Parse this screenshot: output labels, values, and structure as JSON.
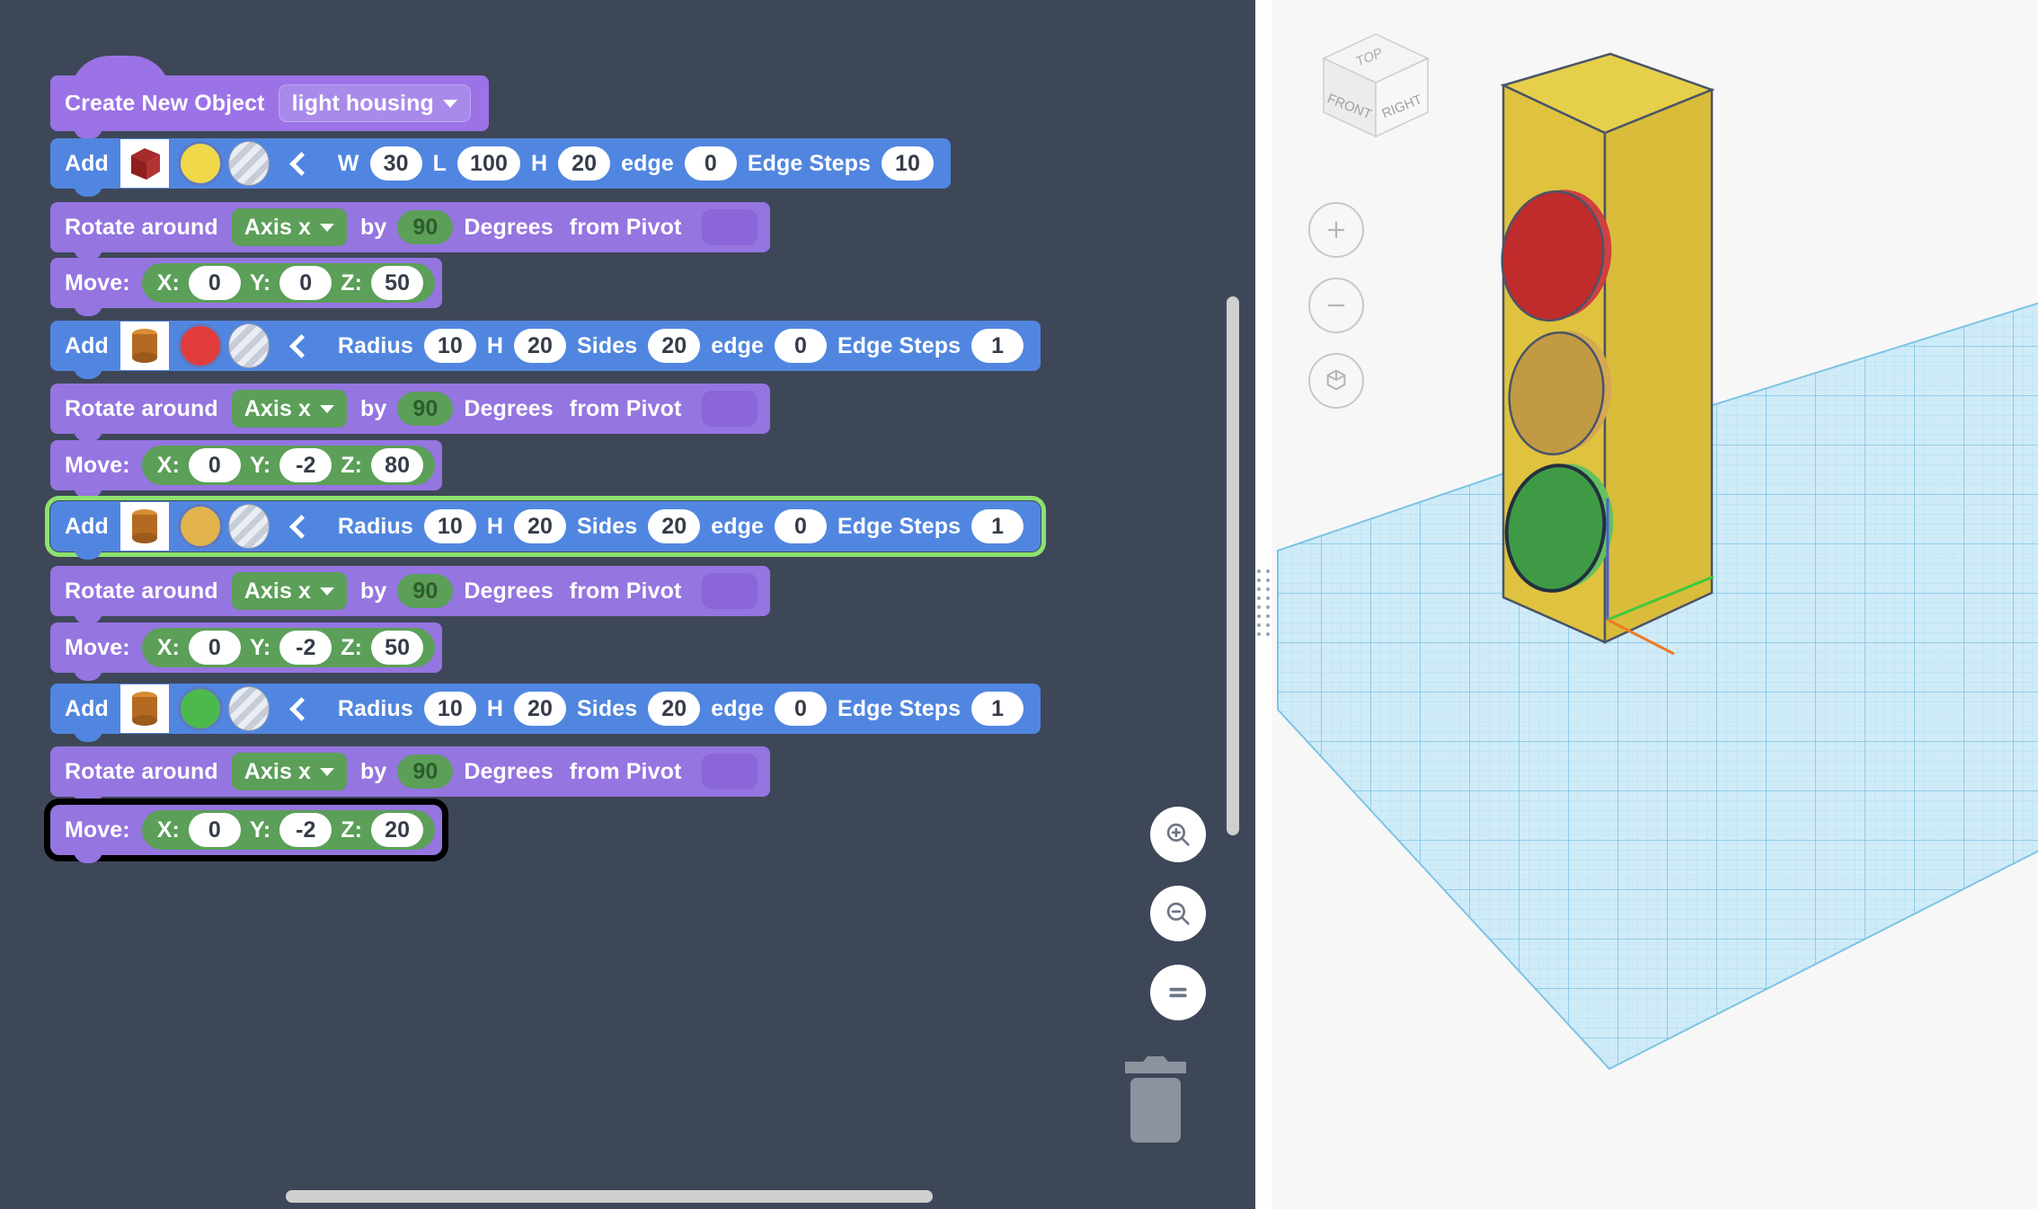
{
  "app": {
    "background_color": "#3e4758",
    "block_purple": "#9575e0",
    "block_blue": "#5186e0",
    "block_green": "#5b9f58",
    "selection_green": "#8ce26e",
    "selection_black": "#000000"
  },
  "editor": {
    "hat": {
      "label": "Create New Object",
      "object_name": "light housing",
      "dropdown_icon": "chevron-down-icon"
    },
    "blocks": [
      {
        "type": "add",
        "label": "Add",
        "shape": "box",
        "shape_thumb": "red-box-thumbnail",
        "color_swatch": "#f0d84a",
        "texture_swatch": "striped-grey",
        "back_icon": "chevron-left-icon",
        "fields": [
          {
            "label": "W",
            "value": "30"
          },
          {
            "label": "L",
            "value": "100"
          },
          {
            "label": "H",
            "value": "20"
          },
          {
            "label": "edge",
            "value": "0"
          },
          {
            "label": "Edge Steps",
            "value": "10"
          }
        ],
        "selected": "none"
      },
      {
        "type": "rotate",
        "label": "Rotate around",
        "axis": "Axis x",
        "by_label": "by",
        "degrees": "90",
        "degrees_label": "Degrees",
        "pivot_label": "from Pivot",
        "pivot_value": "",
        "selected": "none"
      },
      {
        "type": "move",
        "label": "Move:",
        "x_label": "X:",
        "x": "0",
        "y_label": "Y:",
        "y": "0",
        "z_label": "Z:",
        "z": "50",
        "selected": "none"
      },
      {
        "type": "add",
        "label": "Add",
        "shape": "cylinder",
        "shape_thumb": "orange-cylinder-thumbnail",
        "color_swatch": "#e23b3b",
        "texture_swatch": "striped-grey",
        "back_icon": "chevron-left-icon",
        "fields": [
          {
            "label": "Radius",
            "value": "10"
          },
          {
            "label": "H",
            "value": "20"
          },
          {
            "label": "Sides",
            "value": "20"
          },
          {
            "label": "edge",
            "value": "0"
          },
          {
            "label": "Edge Steps",
            "value": "1"
          }
        ],
        "selected": "none"
      },
      {
        "type": "rotate",
        "label": "Rotate around",
        "axis": "Axis x",
        "by_label": "by",
        "degrees": "90",
        "degrees_label": "Degrees",
        "pivot_label": "from Pivot",
        "pivot_value": "",
        "selected": "none"
      },
      {
        "type": "move",
        "label": "Move:",
        "x_label": "X:",
        "x": "0",
        "y_label": "Y:",
        "y": "-2",
        "z_label": "Z:",
        "z": "80",
        "selected": "none"
      },
      {
        "type": "add",
        "label": "Add",
        "shape": "cylinder",
        "shape_thumb": "orange-cylinder-thumbnail",
        "color_swatch": "#e3b44c",
        "texture_swatch": "striped-grey",
        "back_icon": "chevron-left-icon",
        "fields": [
          {
            "label": "Radius",
            "value": "10"
          },
          {
            "label": "H",
            "value": "20"
          },
          {
            "label": "Sides",
            "value": "20"
          },
          {
            "label": "edge",
            "value": "0"
          },
          {
            "label": "Edge Steps",
            "value": "1"
          }
        ],
        "selected": "green-outline"
      },
      {
        "type": "rotate",
        "label": "Rotate around",
        "axis": "Axis x",
        "by_label": "by",
        "degrees": "90",
        "degrees_label": "Degrees",
        "pivot_label": "from Pivot",
        "pivot_value": "",
        "selected": "none"
      },
      {
        "type": "move",
        "label": "Move:",
        "x_label": "X:",
        "x": "0",
        "y_label": "Y:",
        "y": "-2",
        "z_label": "Z:",
        "z": "50",
        "selected": "none"
      },
      {
        "type": "add",
        "label": "Add",
        "shape": "cylinder",
        "shape_thumb": "orange-cylinder-thumbnail",
        "color_swatch": "#4cb94c",
        "texture_swatch": "striped-grey",
        "back_icon": "chevron-left-icon",
        "fields": [
          {
            "label": "Radius",
            "value": "10"
          },
          {
            "label": "H",
            "value": "20"
          },
          {
            "label": "Sides",
            "value": "20"
          },
          {
            "label": "edge",
            "value": "0"
          },
          {
            "label": "Edge Steps",
            "value": "1"
          }
        ],
        "selected": "none"
      },
      {
        "type": "rotate",
        "label": "Rotate around",
        "axis": "Axis x",
        "by_label": "by",
        "degrees": "90",
        "degrees_label": "Degrees",
        "pivot_label": "from Pivot",
        "pivot_value": "",
        "selected": "none"
      },
      {
        "type": "move",
        "label": "Move:",
        "x_label": "X:",
        "x": "0",
        "y_label": "Y:",
        "y": "-2",
        "z_label": "Z:",
        "z": "20",
        "selected": "black-outline"
      }
    ],
    "tools": [
      {
        "name": "zoom-in-button",
        "icon": "magnifier-plus-icon"
      },
      {
        "name": "zoom-out-button",
        "icon": "magnifier-minus-icon"
      },
      {
        "name": "zoom-reset-button",
        "icon": "equals-icon"
      }
    ],
    "trash": {
      "icon": "trash-icon"
    },
    "scrollbars": {
      "horizontal": "h-scrollbar",
      "vertical": "v-scrollbar"
    }
  },
  "viewport": {
    "view_cube": {
      "top": "TOP",
      "front": "FRONT",
      "right": "RIGHT"
    },
    "controls": [
      {
        "name": "viewport-zoom-in-button",
        "icon": "plus-icon"
      },
      {
        "name": "viewport-zoom-out-button",
        "icon": "minus-icon"
      },
      {
        "name": "viewport-fit-button",
        "icon": "cube-fit-icon"
      }
    ],
    "scene": {
      "object": "traffic-light",
      "housing_color": "#e0c23c",
      "lights": [
        "#cc2a2a",
        "#c39a3c",
        "#3f9f43"
      ],
      "grid_color": "#bfe4f5"
    }
  }
}
